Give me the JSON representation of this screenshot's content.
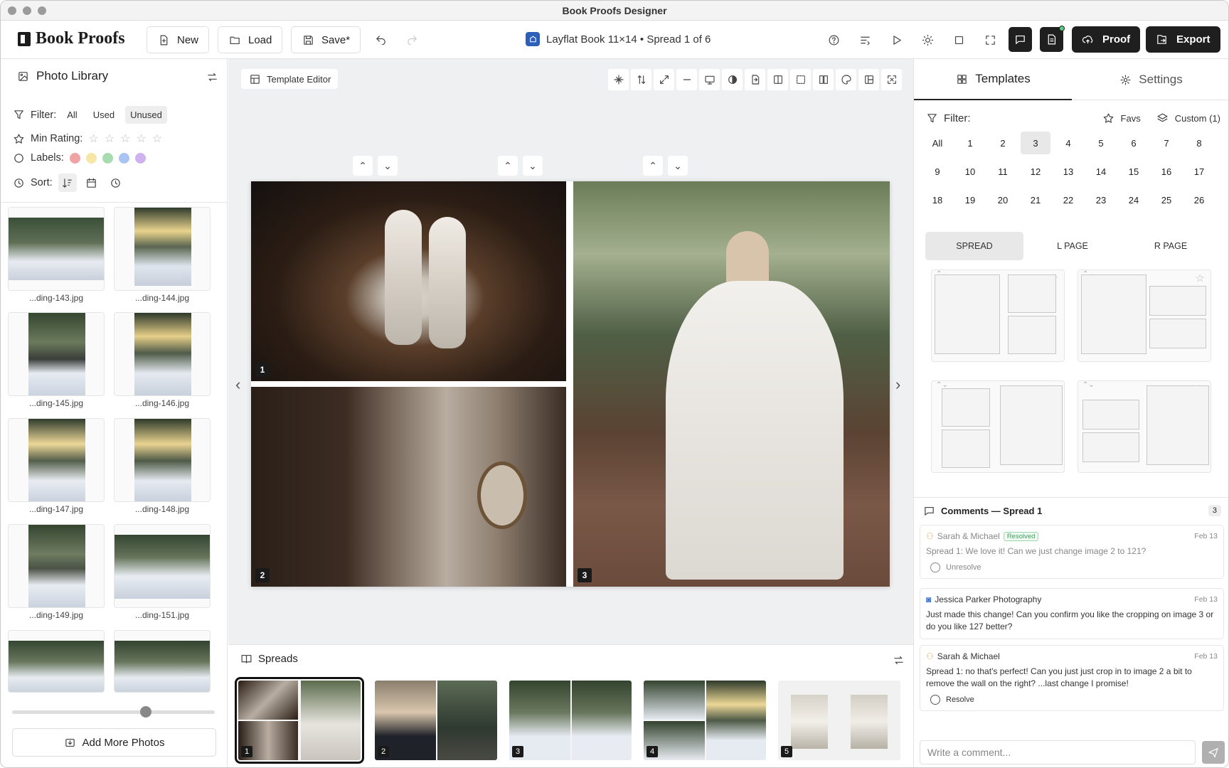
{
  "window": {
    "title": "Book Proofs Designer"
  },
  "toolbar": {
    "logo": "Book Proofs",
    "new_label": "New",
    "load_label": "Load",
    "save_label": "Save*",
    "book_info": "Layflat Book 11×14 • Spread 1 of 6",
    "proof_label": "Proof",
    "export_label": "Export"
  },
  "library": {
    "title": "Photo Library",
    "filter_label": "Filter:",
    "filters": [
      "All",
      "Used",
      "Unused"
    ],
    "selected_filter": "Unused",
    "min_rating_label": "Min Rating:",
    "labels_label": "Labels:",
    "label_colors": [
      "#f0a3a3",
      "#f6e7a6",
      "#a8dbb0",
      "#a9c4f2",
      "#cfb1ef"
    ],
    "sort_label": "Sort:",
    "photos": [
      {
        "name": "...ding-143.jpg"
      },
      {
        "name": "...ding-144.jpg"
      },
      {
        "name": "...ding-145.jpg"
      },
      {
        "name": "...ding-146.jpg"
      },
      {
        "name": "...ding-147.jpg"
      },
      {
        "name": "...ding-148.jpg"
      },
      {
        "name": "...ding-149.jpg"
      },
      {
        "name": "...ding-151.jpg"
      }
    ],
    "add_more": "Add More Photos"
  },
  "canvas": {
    "template_editor": "Template Editor",
    "slots": [
      "1",
      "2",
      "3"
    ]
  },
  "spreads": {
    "title": "Spreads",
    "items": [
      "1",
      "2",
      "3",
      "4",
      "5"
    ]
  },
  "templates_panel": {
    "tab_templates": "Templates",
    "tab_settings": "Settings",
    "filter_label": "Filter:",
    "favs_label": "Favs",
    "custom_label": "Custom (1)",
    "counts": [
      "All",
      "1",
      "2",
      "3",
      "4",
      "5",
      "6",
      "7",
      "8",
      "9",
      "10",
      "11",
      "12",
      "13",
      "14",
      "15",
      "16",
      "17",
      "18",
      "19",
      "20",
      "21",
      "22",
      "23",
      "24",
      "25",
      "26"
    ],
    "selected_count": "3",
    "page_modes": [
      "SPREAD",
      "L PAGE",
      "R PAGE"
    ],
    "selected_mode": "SPREAD"
  },
  "comments": {
    "title": "Comments — Spread 1",
    "count": "3",
    "items": [
      {
        "author": "Sarah & Michael",
        "badge": "Resolved",
        "date": "Feb 13",
        "text": "Spread 1: We love it! Can we just change image 2 to 121?",
        "action": "Unresolve"
      },
      {
        "author": "Jessica Parker Photography",
        "date": "Feb 13",
        "text": "Just made this change! Can you confirm you like the cropping on image 3 or do you like 127 better?"
      },
      {
        "author": "Sarah & Michael",
        "date": "Feb 13",
        "text": "Spread 1: no that's perfect! Can you just just crop in to image 2 a bit to remove the wall on the right? ...last change I promise!",
        "action": "Resolve"
      }
    ],
    "placeholder": "Write a comment..."
  }
}
